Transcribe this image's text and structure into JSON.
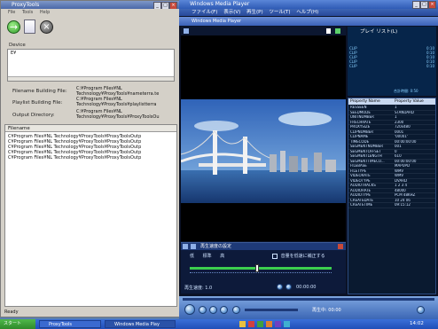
{
  "proxytools": {
    "title": "ProxyTools",
    "menu": [
      "File",
      "Tools",
      "Help"
    ],
    "device_label": "Device",
    "device_value": "E¥",
    "filename_building_label": "Filename Building File:",
    "filename_building_value": "C:¥Program Files¥NL Technology¥ProxyTools¥nameterra.te",
    "playlist_building_label": "Playlist Building File:",
    "playlist_building_value": "C:¥Program Files¥NL Technology¥ProxyTools¥playlistterra",
    "output_dir_label": "Output Directory:",
    "output_dir_value": "C:¥Program Files¥NL Technology¥ProxyTools¥ProxyToolsOu",
    "filename_header": "Filename",
    "files": [
      "C¥Program Files¥NL Technology¥ProxyTools¥ProxyToolsOutp",
      "C¥Program Files¥NL Technology¥ProxyTools¥ProxyToolsOutp",
      "C¥Program Files¥NL Technology¥ProxyTools¥ProxyToolsOutp",
      "C¥Program Files¥NL Technology¥ProxyTools¥ProxyToolsOutp",
      "C¥Program Files¥NL Technology¥ProxyTools¥ProxyToolsOutp"
    ],
    "status": "Ready"
  },
  "wmp": {
    "title": "Windows Media Player",
    "menu": [
      "ファイル(F)",
      "表示(V)",
      "再生(P)",
      "ツール(T)",
      "ヘルプ(H)"
    ],
    "inner_title": "Windows Media Player",
    "playlist_title": "プレイ リスト(L)",
    "playlist_items": [
      {
        "name": "CLIP",
        "time": "0:10"
      },
      {
        "name": "CLIP",
        "time": "0:10"
      },
      {
        "name": "CLIP",
        "time": "0:10"
      },
      {
        "name": "CLIP",
        "time": "0:10"
      },
      {
        "name": "CLIP",
        "time": "0:10"
      }
    ],
    "playlist_total": "合計時間: 0:50",
    "property_header_name": "Property Name",
    "property_header_value": "Property Value",
    "properties": [
      {
        "name": "RESSEEN",
        "value": "1"
      },
      {
        "name": "SEEDMODE",
        "value": "STANDARD"
      },
      {
        "name": "UNITNUMBER",
        "value": "1"
      },
      {
        "name": "FRECHRATE",
        "value": "2300"
      },
      {
        "name": "PROXYSIZE",
        "value": "720x480"
      },
      {
        "name": "CLIPNUMBER",
        "value": "0001"
      },
      {
        "name": "CLIPNAME",
        "value": "'00001'"
      },
      {
        "name": "TIMECODE",
        "value": "00:00:00:00"
      },
      {
        "name": "SEGMENTNUMBER",
        "value": "001"
      },
      {
        "name": "SEGMENTOFFSET",
        "value": "0"
      },
      {
        "name": "SEGMENTLENGTH",
        "value": "610"
      },
      {
        "name": "SEGMENTTIMECO...",
        "value": "00:00:00:00"
      },
      {
        "name": "FILEBASE",
        "value": "MAPUPD"
      },
      {
        "name": "FILETYPE",
        "value": "WMV"
      },
      {
        "name": "VIDEORATE",
        "value": "WMV"
      },
      {
        "name": "VIDEOTYPE",
        "value": "DVARD"
      },
      {
        "name": "AUDIOTRACKS",
        "value": "1 2 3 4"
      },
      {
        "name": "AUDIORATE",
        "value": "48000"
      },
      {
        "name": "AUDIOTYPE",
        "value": "PCM 48KHZ"
      },
      {
        "name": "CREATEDATE",
        "value": "10 24 06"
      },
      {
        "name": "CREATETIME",
        "value": "09:15:12"
      }
    ],
    "enhance_title": "再生速度の設定",
    "enhance_slow": "低",
    "enhance_normal": "標準",
    "enhance_fast": "高",
    "enhance_checkbox": "音量を低速に補正する",
    "speed_label": "再生速度: 1.0",
    "time_readout": "00:00:00",
    "now_playing": "再生中: 00:00"
  },
  "taskbar": {
    "start": "スタート",
    "buttons": [
      "ProxyTools",
      "Windows Media Play"
    ],
    "clock": "14:02"
  },
  "colors": {
    "wmp_bg": "#0b1226",
    "accent_blue": "#2e55a6",
    "slider_green": "#3ccf4e"
  }
}
